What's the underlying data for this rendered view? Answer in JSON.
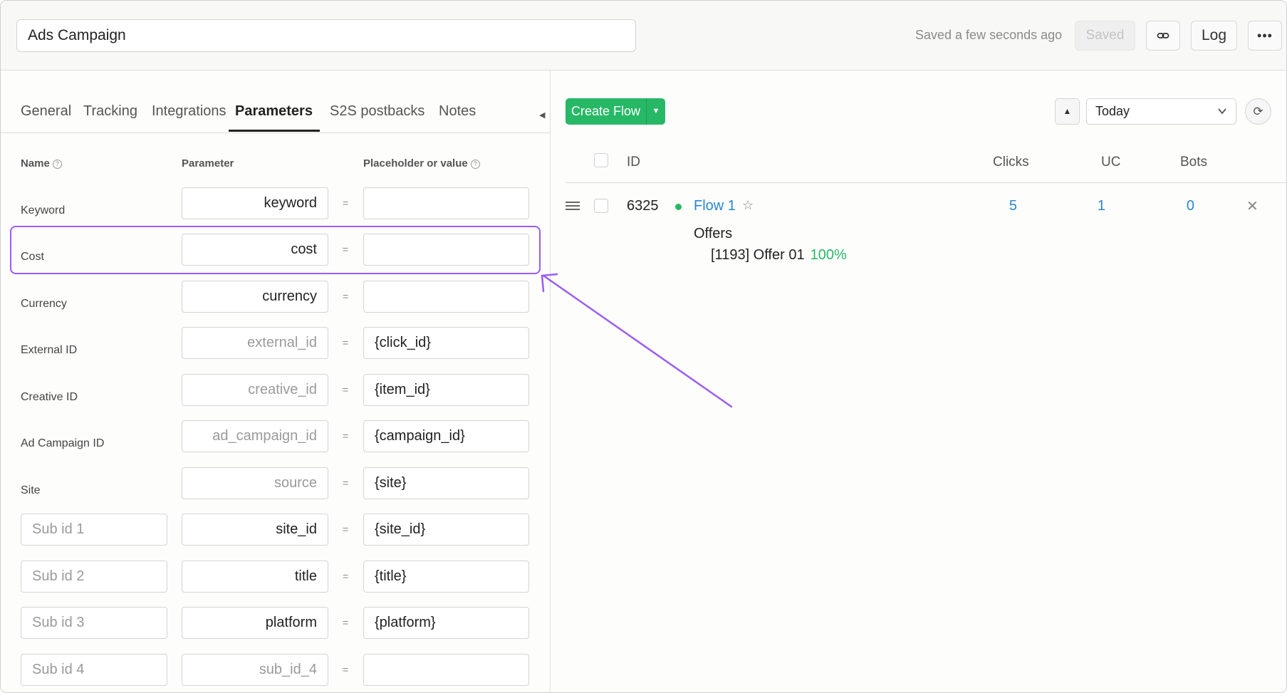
{
  "header": {
    "campaign_name": "Ads Campaign",
    "saved_status": "Saved a few seconds ago",
    "saved_label": "Saved",
    "log_label": "Log",
    "more_label": "•••"
  },
  "tabs": [
    "General",
    "Tracking",
    "Integrations",
    "Parameters",
    "S2S postbacks",
    "Notes"
  ],
  "active_tab": "Parameters",
  "columns": {
    "name": "Name",
    "parameter": "Parameter",
    "placeholder": "Placeholder or value"
  },
  "rows": [
    {
      "name": "Keyword",
      "parameter": "keyword",
      "value": ""
    },
    {
      "name": "Cost",
      "parameter": "cost",
      "value": ""
    },
    {
      "name": "Currency",
      "parameter": "currency",
      "value": ""
    },
    {
      "name": "External ID",
      "parameter": "external_id",
      "value": "{click_id}"
    },
    {
      "name": "Creative ID",
      "parameter": "creative_id",
      "value": "{item_id}"
    },
    {
      "name": "Ad Campaign ID",
      "parameter": "ad_campaign_id",
      "value": "{campaign_id}"
    },
    {
      "name": "Site",
      "parameter": "source",
      "value": "{site}"
    },
    {
      "name": "Sub id 1",
      "parameter": "site_id",
      "value": "{site_id}"
    },
    {
      "name": "Sub id 2",
      "parameter": "title",
      "value": "{title}"
    },
    {
      "name": "Sub id 3",
      "parameter": "platform",
      "value": "{platform}"
    },
    {
      "name": "Sub id 4",
      "parameter": "sub_id_4",
      "value": ""
    }
  ],
  "equals_sign": "=",
  "flows": {
    "create_label": "Create Flow",
    "period": "Today",
    "headers": {
      "id": "ID",
      "clicks": "Clicks",
      "uc": "UC",
      "bots": "Bots"
    },
    "items": [
      {
        "id": "6325",
        "name": "Flow 1",
        "clicks": "5",
        "uc": "1",
        "bots": "0",
        "offers_label": "Offers",
        "offer": "[1193] Offer 01",
        "offer_share": "100%"
      }
    ]
  },
  "colors": {
    "accent_green": "#27b866",
    "link_blue": "#2a87d0",
    "highlight_purple": "#9b5cf6"
  }
}
